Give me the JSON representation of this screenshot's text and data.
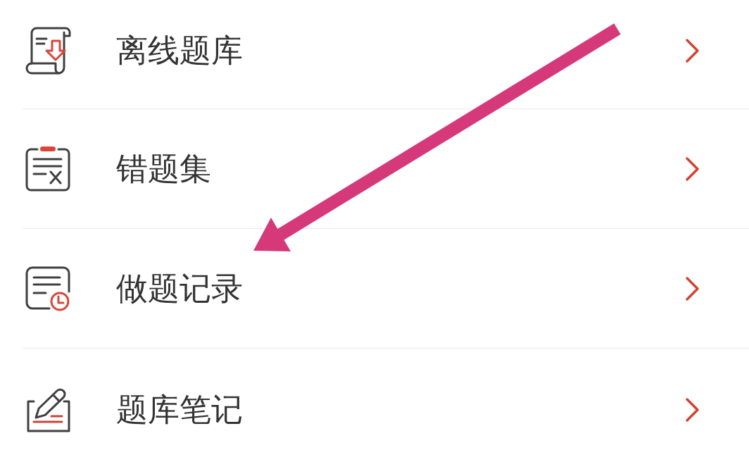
{
  "menu_items": [
    {
      "label": "离线题库"
    },
    {
      "label": "错题集"
    },
    {
      "label": "做题记录"
    },
    {
      "label": "题库笔记"
    }
  ]
}
